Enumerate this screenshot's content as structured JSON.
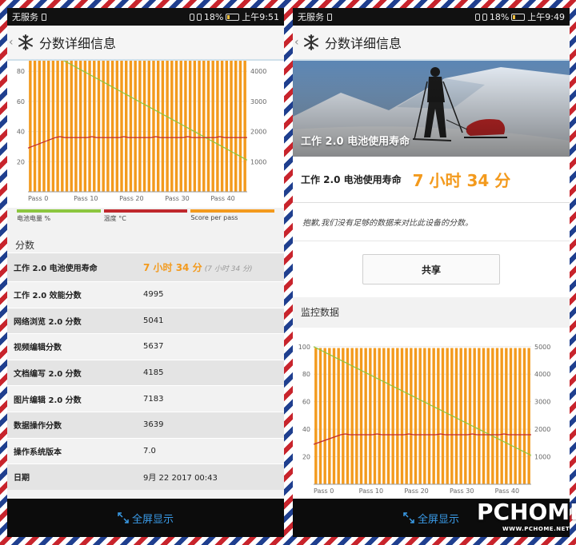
{
  "status": {
    "carrier": "无服务",
    "battery_pct": "18%",
    "time_left": "上午9:51",
    "time_right": "上午9:49"
  },
  "header": {
    "title": "分数详细信息"
  },
  "legend": {
    "battery": "电池电量 %",
    "temp": "温度 °C",
    "score": "Score per pass"
  },
  "scores_section_title": "分数",
  "scores": [
    {
      "label": "工作 2.0 电池使用寿命",
      "value": "7 小时 34 分",
      "sub": "(7 小时 34 分)"
    },
    {
      "label": "工作 2.0 效能分数",
      "value": "4995"
    },
    {
      "label": "网络浏览 2.0 分数",
      "value": "5041"
    },
    {
      "label": "视频编辑分数",
      "value": "5637"
    },
    {
      "label": "文档编写 2.0 分数",
      "value": "4185"
    },
    {
      "label": "图片编辑 2.0 分数",
      "value": "7183"
    },
    {
      "label": "数据操作分数",
      "value": "3639"
    },
    {
      "label": "操作系统版本",
      "value": "7.0"
    },
    {
      "label": "日期",
      "value": "9月 22 2017 00:43"
    }
  ],
  "hero_caption": "工作 2.0 电池使用寿命",
  "result": {
    "label": "工作 2.0 电池使用寿命",
    "value": "7 小时 34 分"
  },
  "sorry_text": "抱歉,我们没有足够的数据来对比此设备的分数。",
  "share_label": "共享",
  "monitor_title": "监控数据",
  "fullscreen_label": "全屏显示",
  "watermark": {
    "main": "PCHOME",
    "sub": "WWW.PCHOME.NET"
  },
  "colors": {
    "orange": "#f39a1d",
    "battery_green": "#8cc63f",
    "temp_red": "#c0282d",
    "link_blue": "#3a9be8"
  },
  "chart_data": [
    {
      "type": "bar",
      "xlabel": "",
      "ylabel": "",
      "x_ticks": [
        "Pass 0",
        "Pass 10",
        "Pass 20",
        "Pass 30",
        "Pass 40"
      ],
      "passes": 48,
      "y_left_ticks": [
        20,
        40,
        60,
        80
      ],
      "y_right_ticks": [
        1000,
        2000,
        3000,
        4000
      ],
      "ylim_left": [
        0,
        87
      ],
      "ylim_right": [
        0,
        4350
      ],
      "series": [
        {
          "name": "Score per pass",
          "axis": "right",
          "values": "~4950 each pass"
        },
        {
          "name": "电池电量 %",
          "axis": "left",
          "start": 100,
          "end": 21
        },
        {
          "name": "温度 °C",
          "axis": "left",
          "start": 29,
          "plateau": 36
        }
      ]
    },
    {
      "type": "bar",
      "xlabel": "",
      "ylabel": "",
      "x_ticks": [
        "Pass 0",
        "Pass 10",
        "Pass 20",
        "Pass 30",
        "Pass 40"
      ],
      "passes": 48,
      "y_left_ticks": [
        20,
        40,
        60,
        80,
        100
      ],
      "y_right_ticks": [
        1000,
        2000,
        3000,
        4000,
        5000
      ],
      "ylim_left": [
        0,
        108
      ],
      "ylim_right": [
        0,
        5400
      ],
      "series": [
        {
          "name": "Score per pass",
          "axis": "right",
          "values": "~4950 each pass"
        },
        {
          "name": "电池电量 %",
          "axis": "left",
          "start": 100,
          "end": 21
        },
        {
          "name": "温度 °C",
          "axis": "left",
          "start": 29,
          "plateau": 36
        }
      ]
    }
  ]
}
